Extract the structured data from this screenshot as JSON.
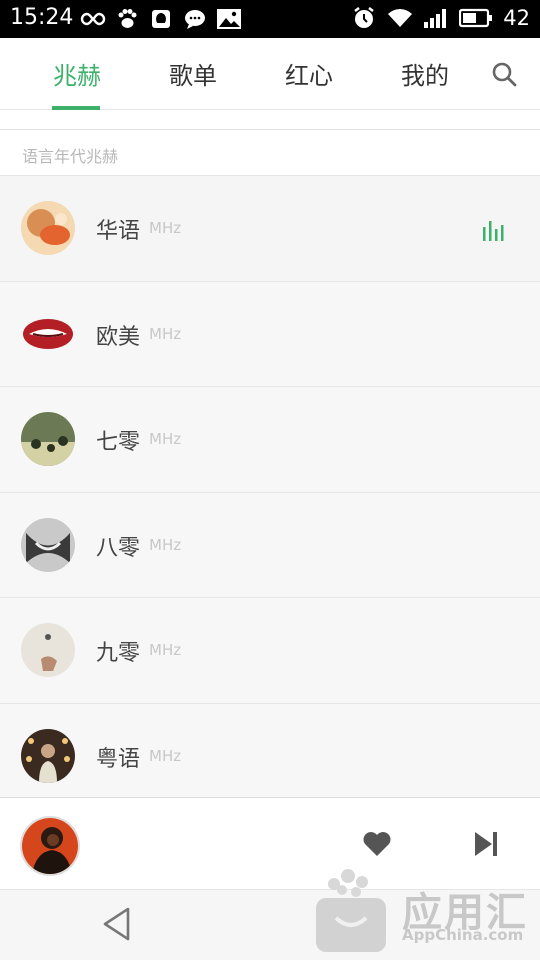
{
  "status_bar": {
    "time": "15:24",
    "battery": "42",
    "left_icons": [
      "infinity-icon",
      "paw-icon",
      "qq-icon",
      "chat-icon",
      "image-icon"
    ],
    "right_icons": [
      "alarm-icon",
      "wifi-icon",
      "signal-icon",
      "battery-icon"
    ]
  },
  "nav": {
    "tabs": [
      {
        "label": "兆赫",
        "active": true
      },
      {
        "label": "歌单",
        "active": false
      },
      {
        "label": "红心",
        "active": false
      },
      {
        "label": "我的",
        "active": false
      }
    ],
    "accent": "#3db06a",
    "search_icon": "search-icon"
  },
  "cut_section_header": "",
  "section_header": "语言年代兆赫",
  "channels": [
    {
      "name": "华语",
      "unit": "MHz",
      "playing": true
    },
    {
      "name": "欧美",
      "unit": "MHz",
      "playing": false
    },
    {
      "name": "七零",
      "unit": "MHz",
      "playing": false
    },
    {
      "name": "八零",
      "unit": "MHz",
      "playing": false
    },
    {
      "name": "九零",
      "unit": "MHz",
      "playing": false
    },
    {
      "name": "粤语",
      "unit": "MHz",
      "playing": false
    }
  ],
  "player": {
    "heart_icon": "heart-icon",
    "next_icon": "next-icon"
  },
  "watermark": {
    "text": "应用汇",
    "sub": "AppChina.com"
  }
}
